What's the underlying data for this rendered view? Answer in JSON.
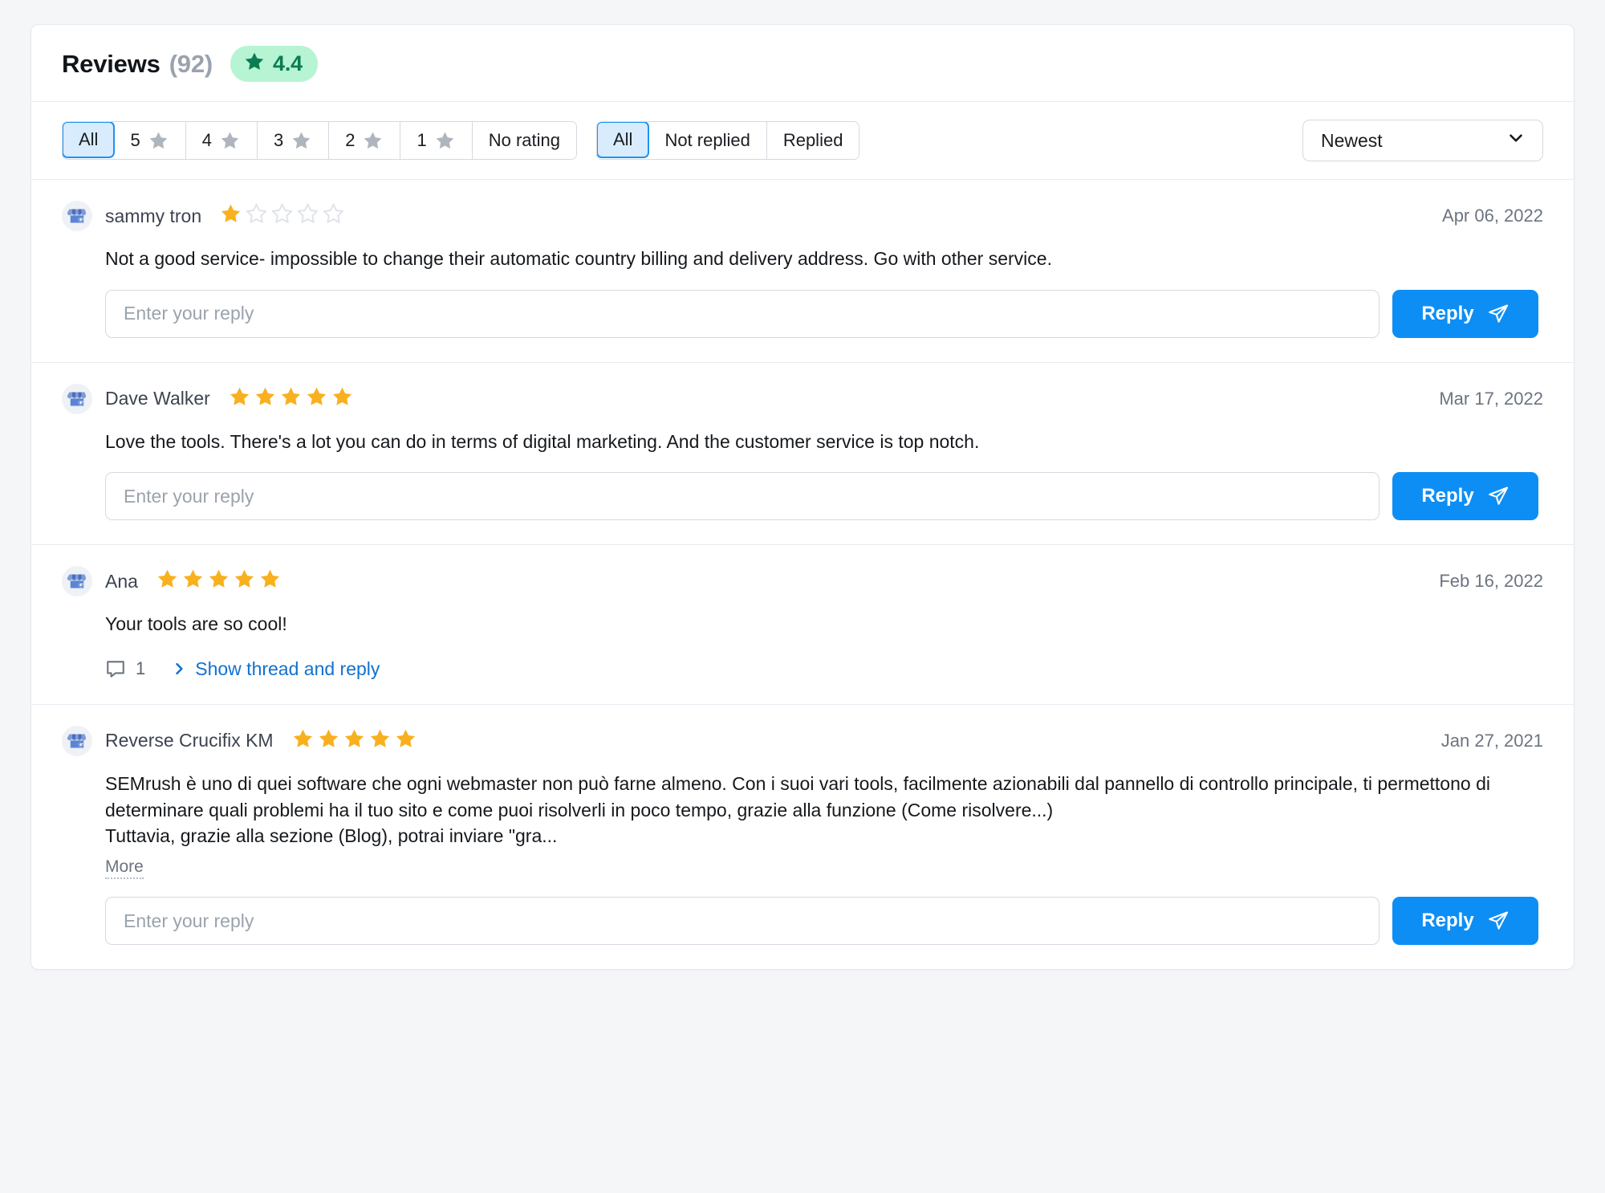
{
  "header": {
    "title": "Reviews",
    "count": "(92)",
    "rating_value": "4.4",
    "rating_pill_bg": "#b7f4d3",
    "rating_text_color": "#0a7d52",
    "star_icon": "star-icon"
  },
  "filters": {
    "rating_group": [
      {
        "label": "All",
        "icon": null,
        "active": true
      },
      {
        "label": "5",
        "icon": "star-icon",
        "active": false
      },
      {
        "label": "4",
        "icon": "star-icon",
        "active": false
      },
      {
        "label": "3",
        "icon": "star-icon",
        "active": false
      },
      {
        "label": "2",
        "icon": "star-icon",
        "active": false
      },
      {
        "label": "1",
        "icon": "star-icon",
        "active": false
      },
      {
        "label": "No rating",
        "icon": null,
        "active": false
      }
    ],
    "reply_group": [
      {
        "label": "All",
        "active": true
      },
      {
        "label": "Not replied",
        "active": false
      },
      {
        "label": "Replied",
        "active": false
      }
    ],
    "sort": {
      "selected": "Newest",
      "chevron_icon": "chevron-down-icon"
    },
    "active_color": "#1f93f2",
    "active_bg": "#d9ecfd"
  },
  "reply_ui": {
    "placeholder": "Enter your reply",
    "button_label": "Reply",
    "button_icon": "send-icon",
    "button_color": "#0d8ef5"
  },
  "reviews": [
    {
      "avatar_icon": "google-business-storefront-icon",
      "author": "sammy tron",
      "rating": 1,
      "date": "Apr 06, 2022",
      "body": [
        "Not a good service- impossible to change their automatic country billing and delivery address. Go with other service."
      ],
      "has_reply_box": true,
      "has_more": false,
      "thread": null
    },
    {
      "avatar_icon": "google-business-storefront-icon",
      "author": "Dave Walker",
      "rating": 5,
      "date": "Mar 17, 2022",
      "body": [
        "Love the tools. There's a lot you can do in terms of digital marketing. And the customer service is top notch."
      ],
      "has_reply_box": true,
      "has_more": false,
      "thread": null
    },
    {
      "avatar_icon": "google-business-storefront-icon",
      "author": "Ana",
      "rating": 5,
      "date": "Feb 16, 2022",
      "body": [
        "Your tools are so cool!"
      ],
      "has_reply_box": false,
      "has_more": false,
      "thread": {
        "comment_icon": "comment-bubble-icon",
        "count": "1",
        "chevron_icon": "chevron-right-icon",
        "label": "Show thread and reply"
      }
    },
    {
      "avatar_icon": "google-business-storefront-icon",
      "author": "Reverse Crucifix KM",
      "rating": 5,
      "date": "Jan 27, 2021",
      "body": [
        "SEMrush è uno di quei software che ogni webmaster non può farne almeno. Con i suoi vari tools, facilmente azionabili dal pannello di controllo principale, ti permettono di determinare quali problemi ha il tuo sito e come puoi risolverli in poco tempo, grazie alla funzione (Come risolvere...)",
        "Tuttavia, grazie alla sezione (Blog), potrai inviare \"gra..."
      ],
      "has_reply_box": true,
      "has_more": true,
      "more_label": "More",
      "thread": null
    }
  ]
}
